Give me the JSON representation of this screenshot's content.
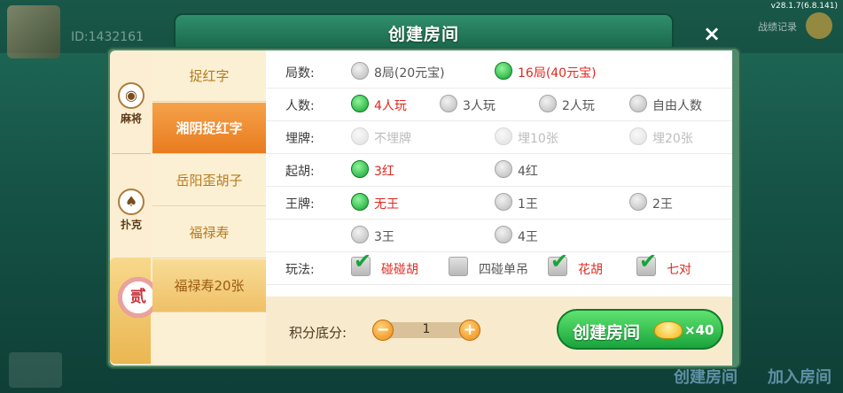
{
  "app": {
    "version": "v28.1.7(6.8.141)"
  },
  "background": {
    "user_id": "ID:1432161",
    "top_right_label": "战绩记录",
    "bottom_buttons": [
      "创建房间",
      "加入房间"
    ]
  },
  "dialog": {
    "title": "创建房间",
    "close_icon": "×",
    "categories": [
      {
        "label": "麻将",
        "icon": "mahjong-tile-icon",
        "glyph": "◉"
      },
      {
        "label": "扑克",
        "icon": "spade-icon",
        "glyph": "♠"
      }
    ],
    "special_badge": "贰",
    "game_tabs": [
      {
        "label": "捉红字",
        "state": "normal"
      },
      {
        "label": "湘阴捉红字",
        "state": "active"
      },
      {
        "label": "岳阳歪胡子",
        "state": "normal"
      },
      {
        "label": "福禄寿",
        "state": "normal"
      },
      {
        "label": "福禄寿20张",
        "state": "special"
      }
    ],
    "rows": [
      {
        "label": "局数:",
        "type": "radio",
        "options": [
          {
            "text": "8局(20元宝)",
            "state": "off"
          },
          {
            "text": "16局(40元宝)",
            "state": "on"
          }
        ]
      },
      {
        "label": "人数:",
        "type": "radio",
        "options": [
          {
            "text": "4人玩",
            "state": "on"
          },
          {
            "text": "3人玩",
            "state": "off"
          },
          {
            "text": "2人玩",
            "state": "off"
          },
          {
            "text": "自由人数",
            "state": "off"
          }
        ]
      },
      {
        "label": "埋牌:",
        "type": "radio",
        "options": [
          {
            "text": "不埋牌",
            "state": "disabled"
          },
          {
            "text": "埋10张",
            "state": "disabled"
          },
          {
            "text": "埋20张",
            "state": "disabled"
          }
        ]
      },
      {
        "label": "起胡:",
        "type": "radio",
        "options": [
          {
            "text": "3红",
            "state": "on"
          },
          {
            "text": "4红",
            "state": "off"
          }
        ]
      },
      {
        "label": "王牌:",
        "type": "radio",
        "options": [
          {
            "text": "无王",
            "state": "on"
          },
          {
            "text": "1王",
            "state": "off"
          },
          {
            "text": "2王",
            "state": "off"
          }
        ]
      },
      {
        "label": "",
        "type": "radio",
        "options": [
          {
            "text": "3王",
            "state": "off"
          },
          {
            "text": "4王",
            "state": "off"
          }
        ]
      },
      {
        "label": "玩法:",
        "type": "check",
        "options": [
          {
            "text": "碰碰胡",
            "state": "on"
          },
          {
            "text": "四碰单吊",
            "state": "off"
          },
          {
            "text": "花胡",
            "state": "on"
          },
          {
            "text": "七对",
            "state": "on"
          }
        ]
      }
    ],
    "score": {
      "label": "积分底分:",
      "value": "1",
      "minus": "−",
      "plus": "+"
    },
    "create_button": {
      "label": "创建房间",
      "cost": "×40"
    },
    "colors": {
      "accent_green": "#19a43c",
      "active_tab": "#e97b1f",
      "selected_text": "#e0281f"
    }
  }
}
